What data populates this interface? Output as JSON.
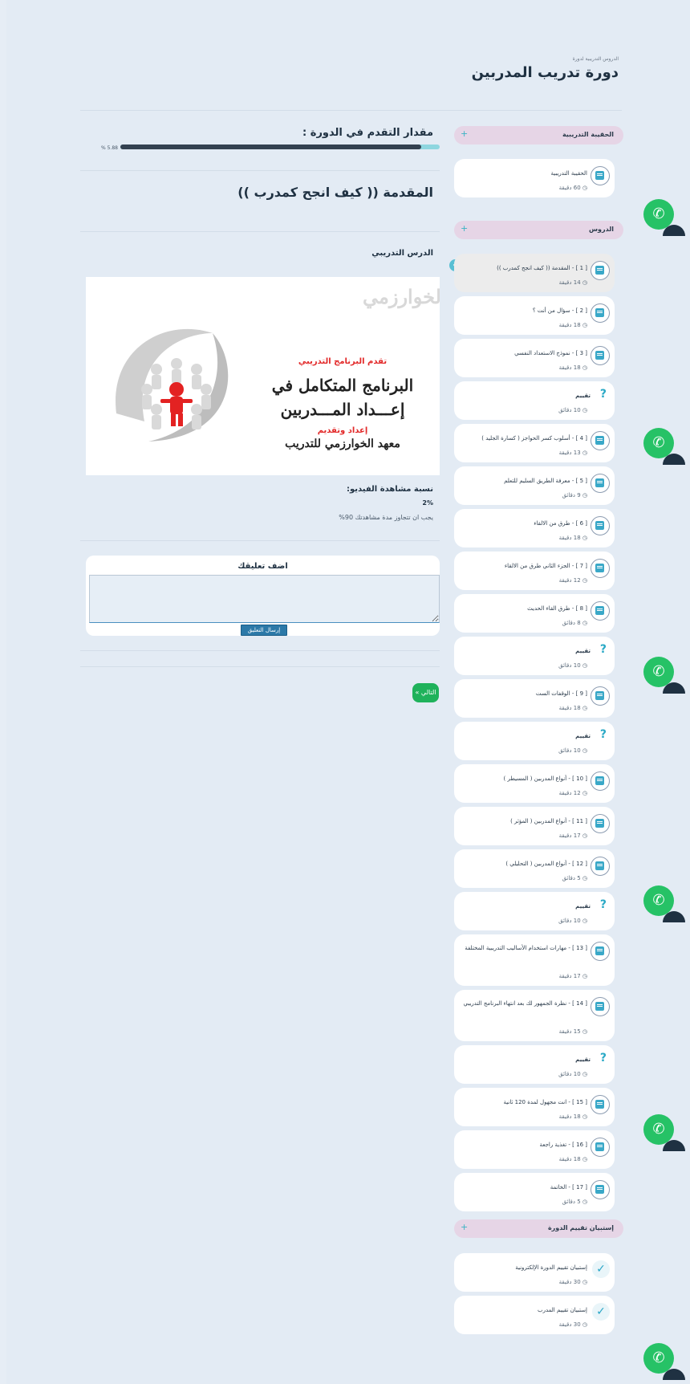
{
  "breadcrumb": "الدروس التدريبية لدورة",
  "course_title": "دورة تدريب المدربين",
  "progress": {
    "label": "مقدار التقدم في الدورة :",
    "percent_text": "% 5.88",
    "value_percent": 5.88
  },
  "lesson_title": "المقدمة (( كيف انجح كمدرب ))",
  "section_label": "الدرس التدريبي",
  "video": {
    "logo_text": "الخوارزمي",
    "presents": "تقدم البرنامج التدريبي",
    "title_line1": "البرنامج المتكامل في",
    "title_line2": "إعـــداد المـــدربين",
    "prepared": "إعداد وتقديم",
    "institute": "معهد الخوارزمي للتدريب"
  },
  "watch": {
    "label": "نسبة مشاهدة الفيديو:",
    "value": "2%",
    "note": "يجب ان تتجاوز مدة مشاهدتك 90%"
  },
  "comment": {
    "title": "اضف تعليقك",
    "placeholder": "",
    "submit": "إرسال التعليق"
  },
  "next_button": "« التالي",
  "sidebar": {
    "bag_header": "الحقيبة التدريبية",
    "bag_items": [
      {
        "title": "الحقيبة التدريبية",
        "duration": "60 دقيقة"
      }
    ],
    "lessons_header": "الدروس",
    "lessons": [
      {
        "title": "[ 1 ] - المقدمة (( كيف انجح كمدرب ))",
        "duration": "14 دقيقة",
        "type": "book",
        "active": true
      },
      {
        "title": "[ 2 ] - سؤال من أنت ؟",
        "duration": "18 دقيقة",
        "type": "book"
      },
      {
        "title": "[ 3 ] - نموذج الاستعداد النفسي",
        "duration": "18 دقيقة",
        "type": "book"
      },
      {
        "title": "تقييم",
        "duration": "10 دقائق",
        "type": "quiz"
      },
      {
        "title": "[ 4 ] - أسلوب كسر الحواجز ( كسارة الجليد )",
        "duration": "13 دقيقة",
        "type": "book"
      },
      {
        "title": "[ 5 ] - معرفة الطريق السليم للتعلم",
        "duration": "9 دقائق",
        "type": "book"
      },
      {
        "title": "[ 6 ] - طرق من الالقاء",
        "duration": "18 دقيقة",
        "type": "book"
      },
      {
        "title": "[ 7 ] - الجزء الثاني طرق من الالقاء",
        "duration": "12 دقيقة",
        "type": "book"
      },
      {
        "title": "[ 8 ] - طرق القاء الحديث",
        "duration": "8 دقائق",
        "type": "book"
      },
      {
        "title": "تقييم",
        "duration": "10 دقائق",
        "type": "quiz"
      },
      {
        "title": "[ 9 ] - الوقفات الست",
        "duration": "18 دقيقة",
        "type": "book"
      },
      {
        "title": "تقييم",
        "duration": "10 دقائق",
        "type": "quiz"
      },
      {
        "title": "[ 10 ] - أنواع المدربين ( المسيطر )",
        "duration": "12 دقيقة",
        "type": "book"
      },
      {
        "title": "[ 11 ] - أنواع المدربين ( المؤثر )",
        "duration": "17 دقيقة",
        "type": "book"
      },
      {
        "title": "[ 12 ] - أنواع المدربين ( التحليلي )",
        "duration": "5 دقائق",
        "type": "book"
      },
      {
        "title": "تقييم",
        "duration": "10 دقائق",
        "type": "quiz"
      },
      {
        "title": "[ 13 ] - مهارات استخدام الأساليب التدريبية المختلفة",
        "duration": "17 دقيقة",
        "type": "book",
        "tall": true
      },
      {
        "title": "[ 14 ] - نظرة الجمهور لك بعد انتهاء البرنامج التدريبي",
        "duration": "15 دقيقة",
        "type": "book",
        "tall": true
      },
      {
        "title": "تقييم",
        "duration": "10 دقائق",
        "type": "quiz"
      },
      {
        "title": "[ 15 ] - انت مجهول لمدة 120 ثانية",
        "duration": "18 دقيقة",
        "type": "book"
      },
      {
        "title": "[ 16 ] - تغذية راجعة",
        "duration": "18 دقيقة",
        "type": "book"
      },
      {
        "title": "[ 17 ] - الخاتمة",
        "duration": "5 دقائق",
        "type": "book"
      }
    ],
    "survey_header": "إستبيان تقييم الدورة",
    "surveys": [
      {
        "title": "إستبيان تقييم الدورة الإلكترونية",
        "duration": "30 دقيقة"
      },
      {
        "title": "إستبيان تقييم المدرب",
        "duration": "30 دقيقة"
      }
    ]
  },
  "whatsapp_icon": "whatsapp-icon",
  "colors": {
    "accent": "#3bb3c3",
    "progress_fill": "#334150",
    "next_button": "#1fb25b",
    "whatsapp": "#26c266"
  }
}
